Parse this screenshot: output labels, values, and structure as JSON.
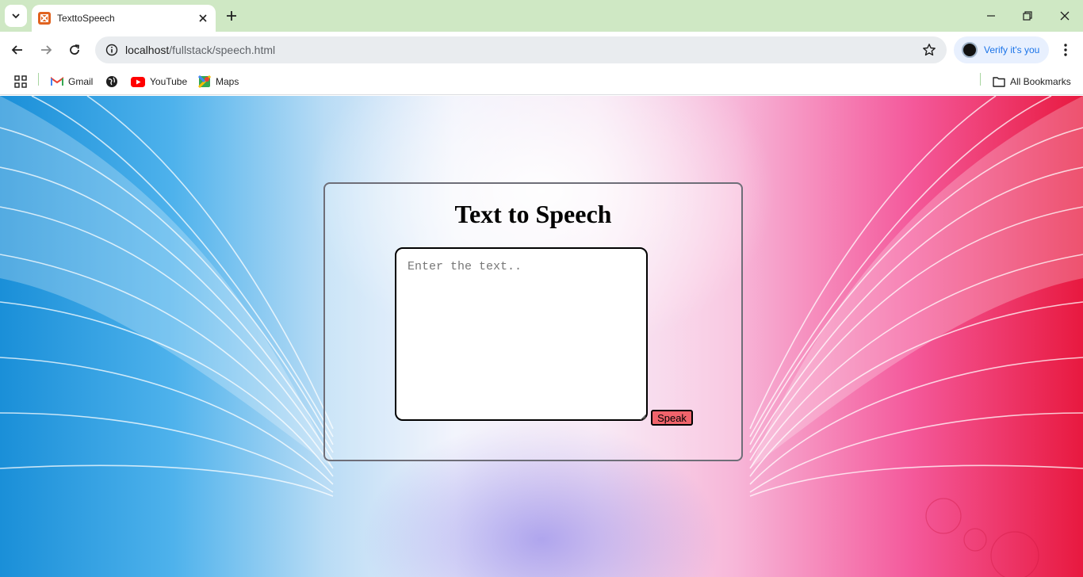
{
  "browser": {
    "tab": {
      "title": "TexttoSpeech",
      "favicon": "xampp-icon"
    },
    "url": {
      "host": "localhost",
      "path": "/fullstack/speech.html"
    },
    "profile": {
      "label": "Verify it's you"
    },
    "bookmarks": [
      {
        "label": "Gmail",
        "icon": "gmail-icon"
      },
      {
        "label": "",
        "icon": "globe-icon"
      },
      {
        "label": "YouTube",
        "icon": "youtube-icon"
      },
      {
        "label": "Maps",
        "icon": "maps-icon"
      }
    ],
    "all_bookmarks": "All Bookmarks"
  },
  "page": {
    "title": "Text to Speech",
    "textarea": {
      "placeholder": "Enter the text..",
      "value": ""
    },
    "speak_button": "Speak"
  },
  "colors": {
    "tabstrip": "#cfe8c4",
    "speak_button": "#f0636b",
    "accent_blue": "#1a73e8"
  }
}
